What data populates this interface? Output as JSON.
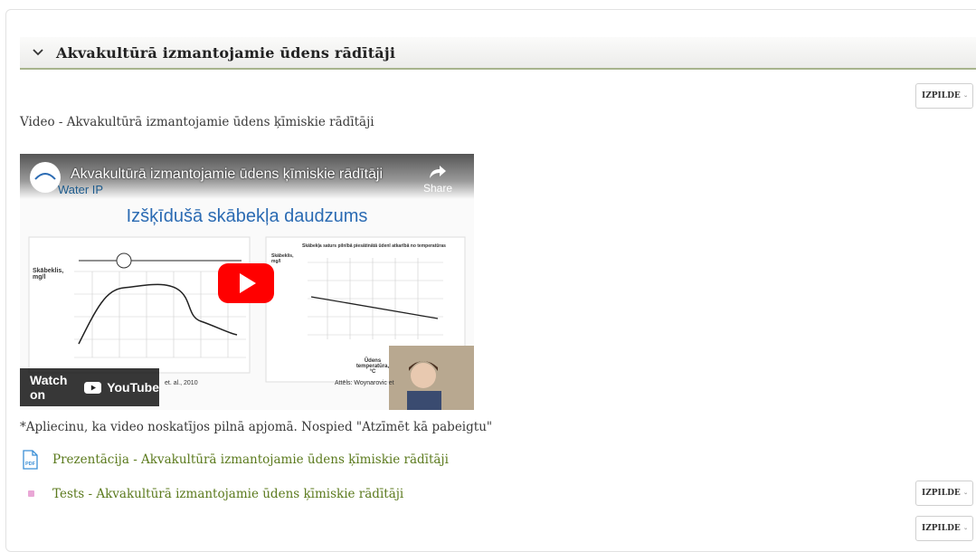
{
  "section": {
    "title": "Akvakultūrā izmantojamie ūdens rādītāji"
  },
  "completion": {
    "label": "IZPILDE"
  },
  "video_label": "Video - Akvakultūrā izmantojamie ūdens ķīmiskie rādītāji",
  "video": {
    "title": "Akvakultūrā izmantojamie ūdens ķīmiskie rādītāji",
    "share": "Share",
    "slide_title": "Izšķīdušā skābekļa daudzums",
    "logo_text": "Water IP",
    "watch_on": "Watch on",
    "youtube": "YouTube",
    "left_chart_ylabel": "Skābeklis, mg/l",
    "right_chart_title": "Skābekļa saturs pilnībā piesātinātā ūdenī atkarībā no temperatūras",
    "right_chart_ylabel": "Skābeklis, mg/l",
    "right_chart_xlabel": "Ūdens temperatūra, °C",
    "left_credit": "et. al., 2010",
    "right_credit": "Attēls: Woynarovic et"
  },
  "note": "*Apliecinu, ka video noskatījos pilnā apjomā. Nospied \"Atzīmēt kā pabeigtu\"",
  "presentation_link": "Prezentācija - Akvakultūrā izmantojamie ūdens ķīmiskie rādītāji",
  "pdf_label": "PDF",
  "test_link": "Tests - Akvakultūrā izmantojamie ūdens ķīmiskie rādītāji",
  "colors": {
    "link": "#5b7a1d",
    "header_border": "#a7b48d",
    "youtube_red": "#ff0000"
  }
}
